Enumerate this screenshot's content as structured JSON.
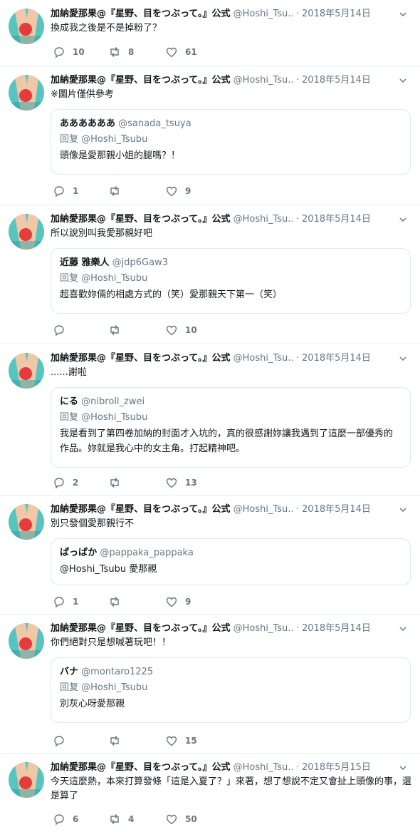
{
  "author": {
    "name": "加納愛那果@『星野、目をつぶって。』公式",
    "handle": "@Hoshi_Tsu..."
  },
  "icons": {
    "reply": "reply-icon",
    "retweet": "retweet-icon",
    "like": "like-icon",
    "more": "chevron-down-icon"
  },
  "colors": {
    "text": "#14171a",
    "muted": "#657786",
    "border": "#e6ecf0"
  },
  "tweets": [
    {
      "dot": "·",
      "date": "2018年5月14日",
      "text": "換成我之後是不是掉粉了？",
      "reply_count": "10",
      "retweet_count": "8",
      "like_count": "61"
    },
    {
      "dot": "·",
      "date": "2018年5月14日",
      "text": "※圖片僅供參考",
      "quote": {
        "name": "ああああああ",
        "handle": "@sanada_tsuya",
        "reply_label": "回复",
        "reply_handle": "@Hoshi_Tsubu",
        "text": "頭像是愛那親小姐的腿嗎？！"
      },
      "reply_count": "1",
      "retweet_count": "",
      "like_count": "9"
    },
    {
      "dot": "·",
      "date": "2018年5月14日",
      "text": "所以說別叫我愛那親好吧",
      "quote": {
        "name": "近藤 雅樂人",
        "handle": "@jdp6Gaw3",
        "reply_label": "回复",
        "reply_handle": "@Hoshi_Tsubu",
        "text": "超喜歡妳倆的相處方式的（笑）愛那親天下第一（笑）"
      },
      "reply_count": "",
      "retweet_count": "",
      "like_count": "10"
    },
    {
      "dot": "·",
      "date": "2018年5月14日",
      "text": "......謝啦",
      "quote": {
        "name": "にる",
        "handle": "@nibroll_zwei",
        "reply_label": "回复",
        "reply_handle": "@Hoshi_Tsubu",
        "text": "我是看到了第四卷加納的封面才入坑的，真的很感謝妳讓我遇到了這麼一部優秀的作品。妳就是我心中的女主角。打起精神吧。"
      },
      "reply_count": "2",
      "retweet_count": "",
      "like_count": "13"
    },
    {
      "dot": "·",
      "date": "2018年5月14日",
      "text": "別只發個愛那親行不",
      "quote": {
        "name": "ぱっぱか",
        "handle": "@pappaka_pappaka",
        "reply_label": "",
        "reply_handle": "",
        "text": "@Hoshi_Tsubu 愛那親"
      },
      "reply_count": "1",
      "retweet_count": "",
      "like_count": "9"
    },
    {
      "dot": "·",
      "date": "2018年5月14日",
      "text": "你們絕對只是想喊著玩吧！！",
      "quote": {
        "name": "バナ",
        "handle": "@montaro1225",
        "reply_label": "回复",
        "reply_handle": "@Hoshi_Tsubu",
        "text": "別灰心呀愛那親"
      },
      "reply_count": "",
      "retweet_count": "",
      "like_count": "15"
    },
    {
      "dot": "·",
      "date": "2018年5月15日",
      "text": "今天這麼熱，本來打算發條「這是入夏了？」來著，想了想說不定又會扯上頭像的事，還是算了",
      "reply_count": "6",
      "retweet_count": "4",
      "like_count": "50"
    }
  ]
}
